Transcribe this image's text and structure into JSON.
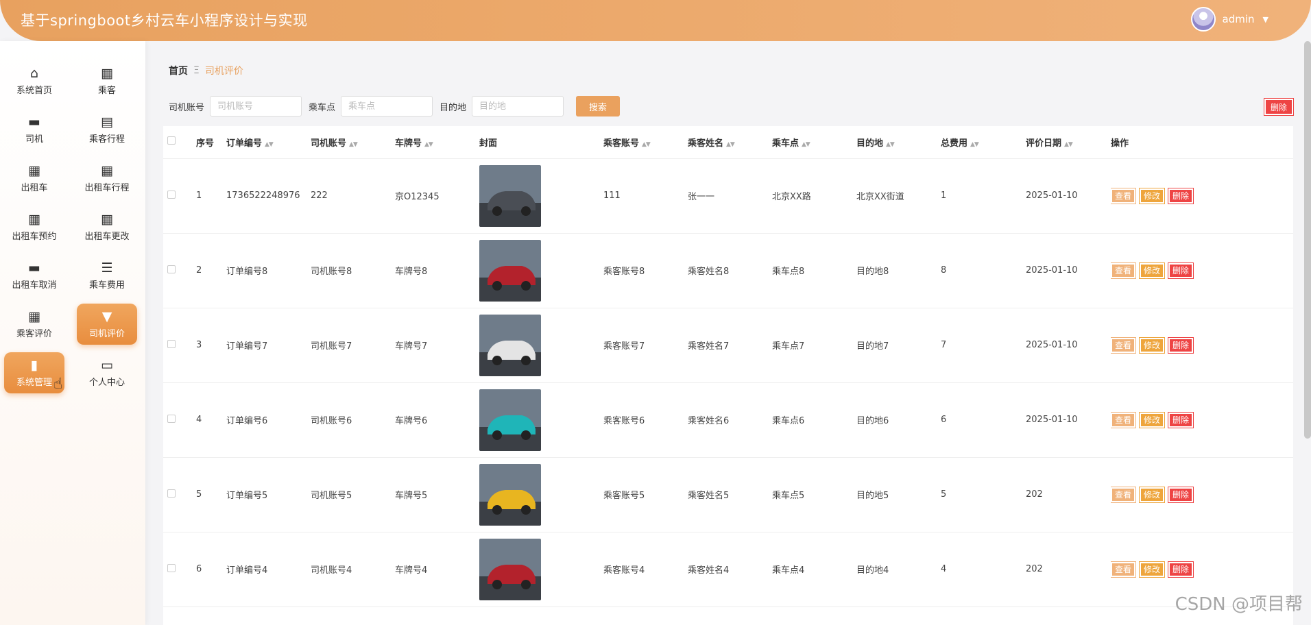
{
  "header": {
    "title": "基于springboot乡村云车小程序设计与实现",
    "user": "admin"
  },
  "sidebar": {
    "items": [
      {
        "label": "系统首页",
        "icon": "⌂"
      },
      {
        "label": "乘客",
        "icon": "▦"
      },
      {
        "label": "司机",
        "icon": "▬"
      },
      {
        "label": "乘客行程",
        "icon": "▤"
      },
      {
        "label": "出租车",
        "icon": "▦"
      },
      {
        "label": "出租车行程",
        "icon": "▦"
      },
      {
        "label": "出租车预约",
        "icon": "▦"
      },
      {
        "label": "出租车更改",
        "icon": "▦"
      },
      {
        "label": "出租车取消",
        "icon": "▬"
      },
      {
        "label": "乘车费用",
        "icon": "☰"
      },
      {
        "label": "乘客评价",
        "icon": "▦"
      },
      {
        "label": "司机评价",
        "icon": "▼"
      },
      {
        "label": "系统管理",
        "icon": "▮"
      },
      {
        "label": "个人中心",
        "icon": "▭"
      }
    ]
  },
  "breadcrumb": {
    "home": "首页",
    "separator": "Ξ",
    "current": "司机评价"
  },
  "search": {
    "driver_label": "司机账号",
    "driver_placeholder": "司机账号",
    "pickup_label": "乘车点",
    "pickup_placeholder": "乘车点",
    "dest_label": "目的地",
    "dest_placeholder": "目的地",
    "button": "搜索"
  },
  "toolbar": {
    "delete_label": "删除"
  },
  "table": {
    "columns": [
      "序号",
      "订单编号",
      "司机账号",
      "车牌号",
      "封面",
      "乘客账号",
      "乘客姓名",
      "乘车点",
      "目的地",
      "总费用",
      "评价日期",
      "操作"
    ],
    "actions": {
      "view": "查看",
      "edit": "修改",
      "delete": "删除"
    },
    "rows": [
      {
        "idx": "1",
        "order": "1736522248976",
        "driver": "222",
        "plate": "京O12345",
        "cover": "#4a4e55",
        "passenger": "111",
        "name": "张一一",
        "pickup": "北京XX路",
        "dest": "北京XX街道",
        "fee": "1",
        "date": "2025-01-10"
      },
      {
        "idx": "2",
        "order": "订单编号8",
        "driver": "司机账号8",
        "plate": "车牌号8",
        "cover": "#b3222c",
        "passenger": "乘客账号8",
        "name": "乘客姓名8",
        "pickup": "乘车点8",
        "dest": "目的地8",
        "fee": "8",
        "date": "2025-01-10"
      },
      {
        "idx": "3",
        "order": "订单编号7",
        "driver": "司机账号7",
        "plate": "车牌号7",
        "cover": "#e4e4e4",
        "passenger": "乘客账号7",
        "name": "乘客姓名7",
        "pickup": "乘车点7",
        "dest": "目的地7",
        "fee": "7",
        "date": "2025-01-10"
      },
      {
        "idx": "4",
        "order": "订单编号6",
        "driver": "司机账号6",
        "plate": "车牌号6",
        "cover": "#1fb5b8",
        "passenger": "乘客账号6",
        "name": "乘客姓名6",
        "pickup": "乘车点6",
        "dest": "目的地6",
        "fee": "6",
        "date": "2025-01-10"
      },
      {
        "idx": "5",
        "order": "订单编号5",
        "driver": "司机账号5",
        "plate": "车牌号5",
        "cover": "#e8b520",
        "passenger": "乘客账号5",
        "name": "乘客姓名5",
        "pickup": "乘车点5",
        "dest": "目的地5",
        "fee": "5",
        "date": "202"
      },
      {
        "idx": "6",
        "order": "订单编号4",
        "driver": "司机账号4",
        "plate": "车牌号4",
        "cover": "#b3222c",
        "passenger": "乘客账号4",
        "name": "乘客姓名4",
        "pickup": "乘车点4",
        "dest": "目的地4",
        "fee": "4",
        "date": "202"
      }
    ]
  },
  "watermark": "CSDN @项目帮",
  "colors": {
    "accent": "#e8a15f",
    "danger": "#ee4444",
    "warning": "#eea53c"
  }
}
